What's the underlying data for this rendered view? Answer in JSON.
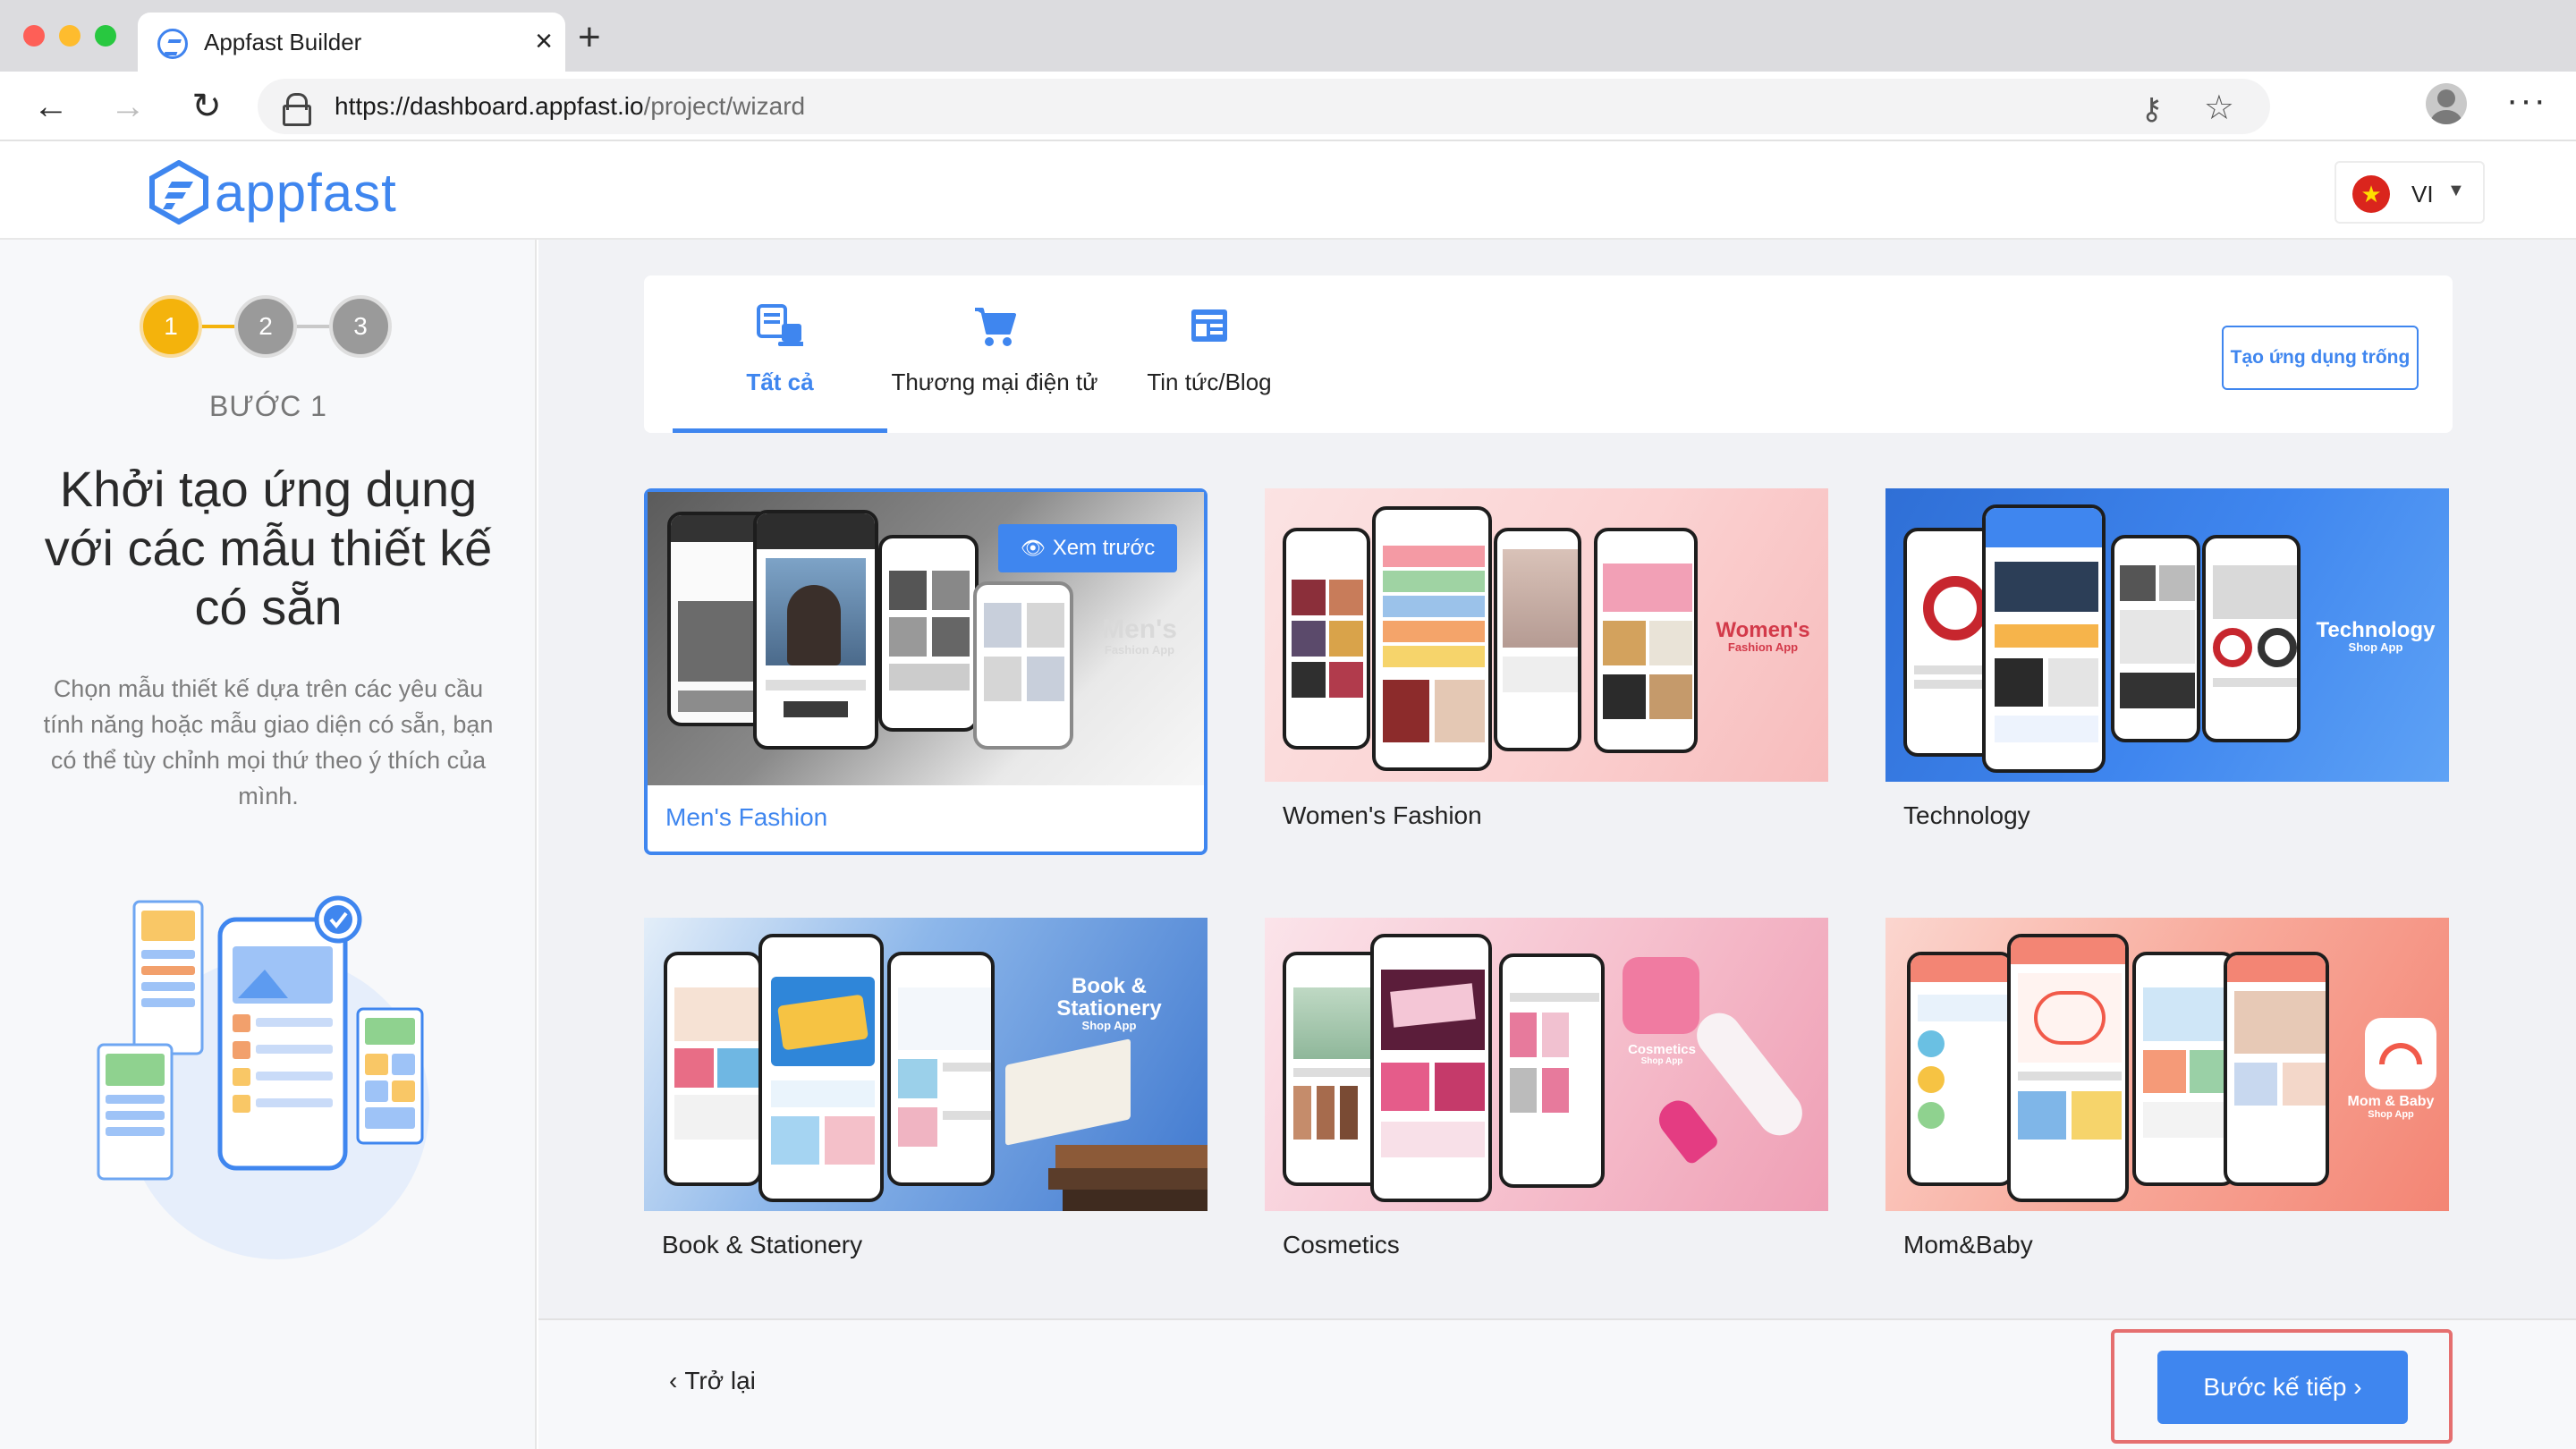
{
  "browser": {
    "tab_title": "Appfast Builder",
    "tab_close": "×",
    "new_tab": "+",
    "url_host": "https://dashboard.appfast.io",
    "url_path": "/project/wizard",
    "menu": "···"
  },
  "header": {
    "logo_text": "appfast",
    "lang_code": "VI",
    "lang_caret": "▼",
    "flag_star": "★"
  },
  "sidebar": {
    "steps": [
      "1",
      "2",
      "3"
    ],
    "step_label": "BƯỚC 1",
    "title": "Khởi tạo ứng dụng với các mẫu thiết kế có sẵn",
    "description": "Chọn mẫu thiết kế dựa trên các yêu cầu tính năng hoặc mẫu giao diện có sẵn, bạn có thể tùy chỉnh mọi thứ theo ý thích của mình."
  },
  "tabs": [
    {
      "label": "Tất cả",
      "icon": "devices-icon",
      "active": true
    },
    {
      "label": "Thương mại điện tử",
      "icon": "cart-icon",
      "active": false
    },
    {
      "label": "Tin tức/Blog",
      "icon": "news-icon",
      "active": false
    }
  ],
  "blank_app_button": "Tạo ứng dụng trống",
  "preview_button": "Xem trước",
  "templates": [
    {
      "name": "Men's Fashion",
      "brand": "Men's",
      "sub": "Fashion App",
      "selected": true
    },
    {
      "name": "Women's Fashion",
      "brand": "Women's",
      "sub": "Fashion App",
      "selected": false
    },
    {
      "name": "Technology",
      "brand": "Technology",
      "sub": "Shop App",
      "selected": false
    },
    {
      "name": "Book & Stationery",
      "brand": "Book & Stationery",
      "sub": "Shop App",
      "selected": false
    },
    {
      "name": "Cosmetics",
      "brand": "Cosmetics",
      "sub": "Shop App",
      "selected": false
    },
    {
      "name": "Mom&Baby",
      "brand": "Mom & Baby",
      "sub": "Shop App",
      "selected": false
    }
  ],
  "footer": {
    "back_label": "Trở lại",
    "next_label": "Bước kế tiếp"
  },
  "colors": {
    "accent": "#3f86ef",
    "step_active": "#f4b30c",
    "highlight": "#e56f6f"
  }
}
